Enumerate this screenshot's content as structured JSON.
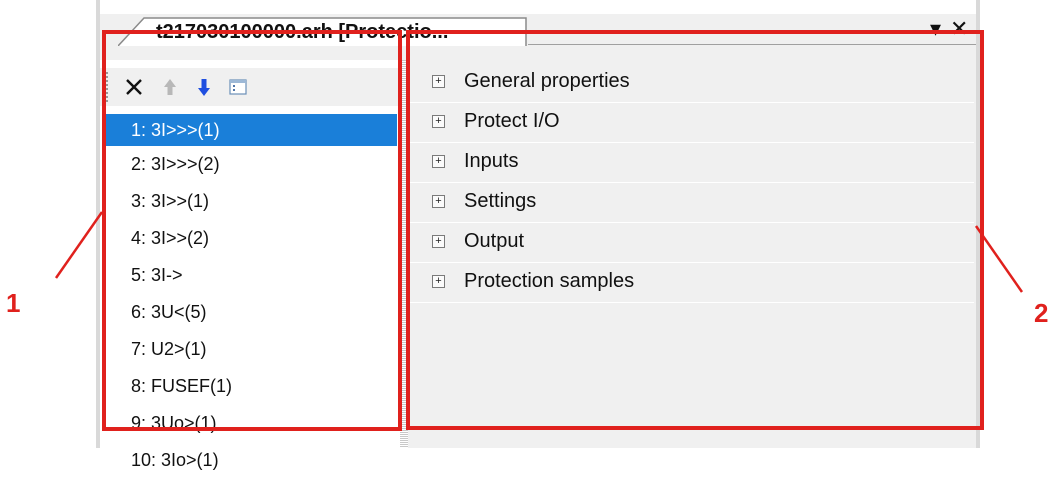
{
  "window": {
    "tab_title": "t217030100000.arh [Protectio...",
    "dropdown_glyph": "▾",
    "close_glyph": "✕"
  },
  "toolbar": {
    "buttons": [
      {
        "name": "delete",
        "icon": "close-x-icon"
      },
      {
        "name": "move-up",
        "icon": "arrow-up-icon",
        "enabled": false
      },
      {
        "name": "move-down",
        "icon": "arrow-down-icon",
        "enabled": true
      },
      {
        "name": "properties",
        "icon": "list-view-icon"
      }
    ]
  },
  "protection_list": {
    "selected_index": 0,
    "items": [
      "1: 3I>>>(1)",
      "2: 3I>>>(2)",
      "3: 3I>>(1)",
      "4: 3I>>(2)",
      "5: 3I->",
      "6: 3U<(5)",
      "7: U2>(1)",
      "8: FUSEF(1)",
      "9: 3Uo>(1)",
      "10: 3Io>(1)"
    ]
  },
  "properties": {
    "expander_glyph": "+",
    "groups": [
      "General properties",
      "Protect I/O",
      "Inputs",
      "Settings",
      "Output",
      "Protection samples"
    ]
  },
  "annotations": {
    "label_1": "1",
    "label_2": "2",
    "color": "#e0211d"
  },
  "colors": {
    "selection": "#1a7fd9",
    "disabled_arrow": "#b8b8b8",
    "enabled_arrow": "#1f4fe0"
  }
}
